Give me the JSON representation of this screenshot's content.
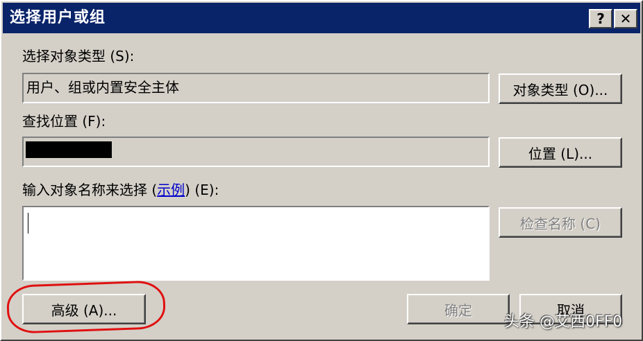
{
  "window": {
    "title": "选择用户或组",
    "help_label": "?",
    "close_label": "✕"
  },
  "object_type": {
    "label": "选择对象类型 (S):",
    "value": "用户、组或内置安全主体",
    "button": "对象类型 (O)..."
  },
  "location": {
    "label": "查找位置 (F):",
    "button": "位置 (L)..."
  },
  "names": {
    "label_prefix": "输入对象名称来选择 (",
    "link": "示例",
    "label_suffix": ") (E):",
    "value": "",
    "check_button": "检查名称 (C)"
  },
  "footer": {
    "advanced": "高级 (A)...",
    "ok": "确定",
    "cancel": "取消"
  },
  "watermark": "头条 @艾西0FF0",
  "colors": {
    "titlebar": "#0a246a",
    "face": "#d4d0c8",
    "highlight_circle": "#e01010",
    "link": "#0000cc"
  }
}
